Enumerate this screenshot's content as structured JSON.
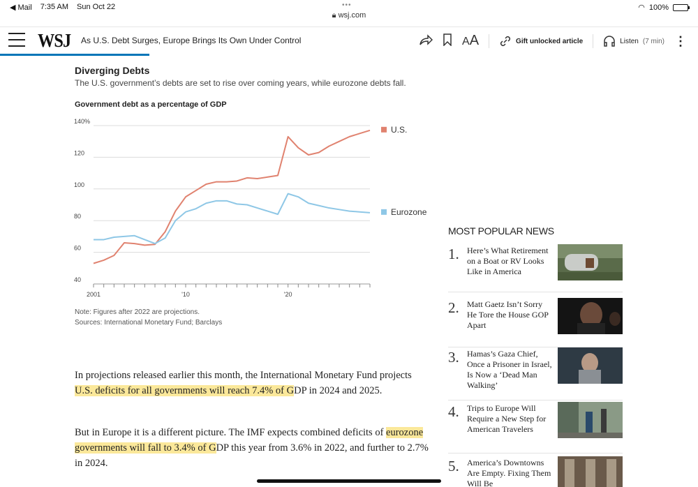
{
  "statusbar": {
    "back_app": "◀ Mail",
    "time": "7:35 AM",
    "date": "Sun Oct 22",
    "battery": "100%",
    "url": "wsj.com"
  },
  "header": {
    "logo": "WSJ",
    "headline": "As U.S. Debt Surges, Europe Brings Its Own Under Control",
    "gift_label": "Gift unlocked article",
    "listen_label": "Listen",
    "listen_minutes": "(7 min)"
  },
  "chart": {
    "title": "Diverging Debts",
    "subtitle": "The U.S. government’s debts are set to rise over coming years, while eurozone debts fall.",
    "label": "Government debt as a percentage of GDP",
    "note": "Note: Figures after 2022 are projections.",
    "sources": "Sources: International Monetary Fund; Barclays"
  },
  "chart_data": {
    "type": "line",
    "title": "Government debt as a percentage of GDP",
    "x": [
      2001,
      2002,
      2003,
      2004,
      2005,
      2006,
      2007,
      2008,
      2009,
      2010,
      2011,
      2012,
      2013,
      2014,
      2015,
      2016,
      2017,
      2018,
      2019,
      2020,
      2021,
      2022,
      2023,
      2024,
      2025,
      2026,
      2027,
      2028
    ],
    "series": [
      {
        "name": "U.S.",
        "color": "#e0826f",
        "values": [
          53,
          55,
          58,
          66,
          65.5,
          64.5,
          65,
          73,
          86,
          95,
          99,
          103,
          104.5,
          104.5,
          105,
          107,
          106.5,
          107.5,
          108.5,
          133,
          126,
          121.5,
          123,
          127,
          130,
          133,
          135,
          137
        ]
      },
      {
        "name": "Eurozone",
        "color": "#8ec7e6",
        "values": [
          68,
          68,
          69.5,
          70,
          70.5,
          68,
          65.5,
          69,
          80,
          85.5,
          87.5,
          91,
          92.5,
          92.5,
          90.5,
          90,
          88,
          86,
          84,
          97,
          95,
          91,
          89.5,
          88,
          87,
          86,
          85.5,
          85
        ]
      }
    ],
    "yticks": [
      "140%",
      "120",
      "100",
      "80",
      "60",
      "40"
    ],
    "ytick_values": [
      140,
      120,
      100,
      80,
      60,
      40
    ],
    "xtick_labels": [
      {
        "year": 2001,
        "label": "2001"
      },
      {
        "year": 2010,
        "label": "'10"
      },
      {
        "year": 2020,
        "label": "'20"
      }
    ],
    "xlim": [
      2001,
      2028
    ],
    "ylim": [
      40,
      140
    ],
    "grid": true,
    "legend": "right"
  },
  "article": {
    "p1_a": "In projections released earlier this month, the International Monetary Fund projects ",
    "p1_hl": "U.S. deficits for all governments will reach 7.4% of G",
    "p1_b": "DP in 2024 and 2025.",
    "p2_a": "But in Europe it is a different picture. The IMF expects combined deficits of ",
    "p2_hl": "eurozone governments will fall to 3.4% of G",
    "p2_b": "DP this year from 3.6% in 2022, and further to 2.7% in 2024."
  },
  "most_popular": {
    "title": "MOST POPULAR NEWS",
    "items": [
      {
        "num": "1.",
        "text": "Here’s What Retirement on a Boat or RV Looks Like in America"
      },
      {
        "num": "2.",
        "text": "Matt Gaetz Isn’t Sorry He Tore the House GOP Apart"
      },
      {
        "num": "3.",
        "text": "Hamas’s Gaza Chief, Once a Prisoner in Israel, Is Now a ‘Dead Man Walking’"
      },
      {
        "num": "4.",
        "text": "Trips to Europe Will Require a New Step for American Travelers"
      },
      {
        "num": "5.",
        "text": "America’s Downtowns Are Empty. Fixing Them Will Be"
      }
    ]
  }
}
